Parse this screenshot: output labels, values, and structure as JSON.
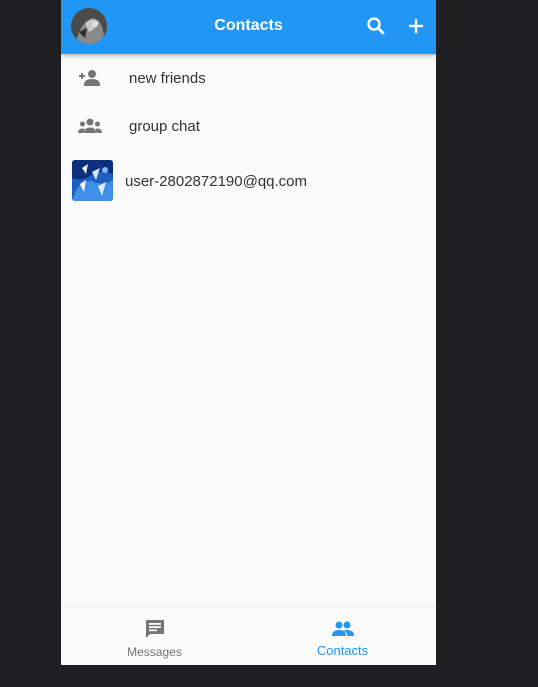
{
  "appbar": {
    "title": "Contacts",
    "avatar_icon": "user-avatar-photo",
    "search_icon": "search-icon",
    "add_icon": "plus-icon",
    "color": "#2196f3"
  },
  "list": {
    "items": [
      {
        "label": "new friends",
        "icon": "person-add-icon"
      },
      {
        "label": "group chat",
        "icon": "group-icon"
      }
    ],
    "contacts": [
      {
        "name": "user-2802872190@qq.com",
        "avatar": "blue-abstract-avatar"
      }
    ]
  },
  "bottom_nav": {
    "items": [
      {
        "label": "Messages",
        "icon": "chat-icon",
        "active": false
      },
      {
        "label": "Contacts",
        "icon": "people-icon",
        "active": true
      }
    ],
    "active_color": "#2196f3",
    "inactive_color": "#757575"
  }
}
